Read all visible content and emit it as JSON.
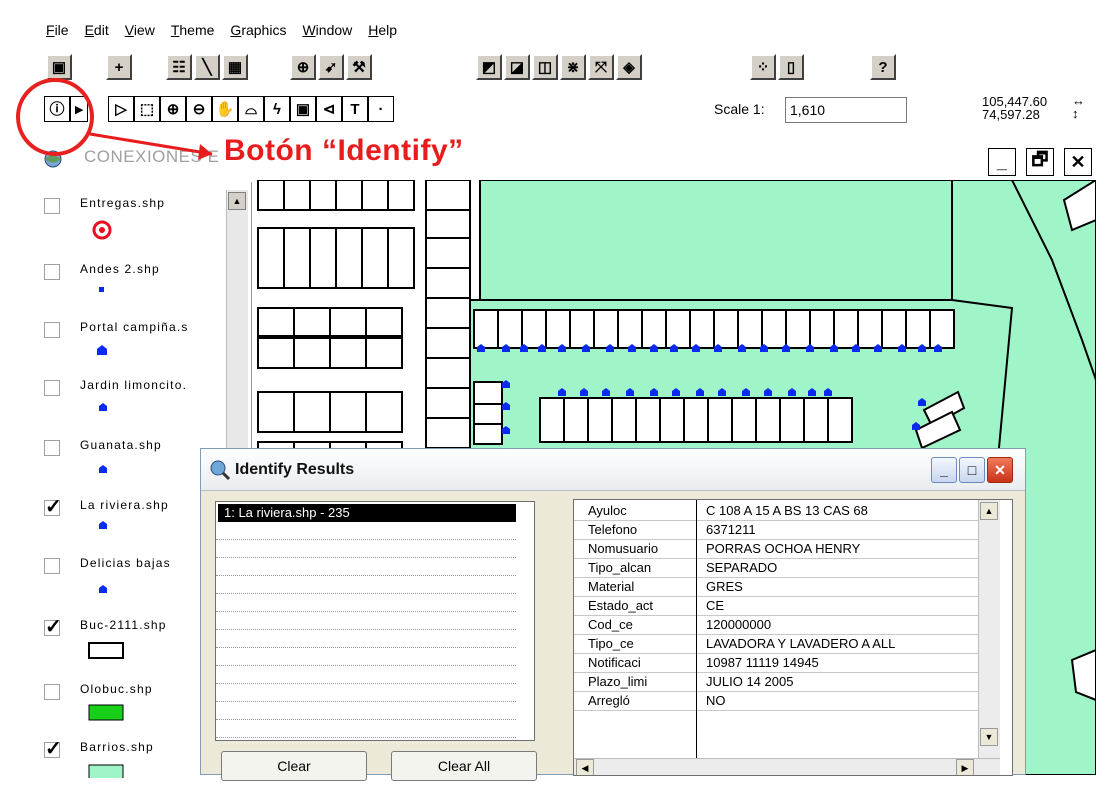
{
  "menubar": {
    "items": [
      "File",
      "Edit",
      "View",
      "Theme",
      "Graphics",
      "Window",
      "Help"
    ]
  },
  "toolbar": {
    "scale_label": "Scale 1:",
    "scale_value": "1,610",
    "coord_x": "105,447.60",
    "coord_y": "74,597.28"
  },
  "document": {
    "title": "CONEXIONES E",
    "window_controls": {
      "minimize": "_",
      "restore": "🗗",
      "close": "✕"
    }
  },
  "annotation": {
    "label": "Botón “Identify”",
    "color": "#e81c1c"
  },
  "layers": [
    {
      "name": "Entregas.shp",
      "checked": false
    },
    {
      "name": "Andes 2.shp",
      "checked": false
    },
    {
      "name": "Portal campiña.s",
      "checked": false
    },
    {
      "name": "Jardin limoncito.",
      "checked": false
    },
    {
      "name": "Guanata.shp",
      "checked": false
    },
    {
      "name": "La riviera.shp",
      "checked": true
    },
    {
      "name": "Delicias bajas",
      "checked": false
    },
    {
      "name": "Buc-2111.shp",
      "checked": true
    },
    {
      "name": "Olobuc.shp",
      "checked": false
    },
    {
      "name": "Barrios.shp",
      "checked": true
    }
  ],
  "identify_dialog": {
    "title": "Identify Results",
    "selected_feature": "1:  La riviera.shp - 235",
    "clear_button": "Clear",
    "clear_all_button": "Clear All",
    "attributes": [
      {
        "field": "Ayuloc",
        "value": "C 108 A 15 A BS 13 CAS 68"
      },
      {
        "field": "Telefono",
        "value": "6371211"
      },
      {
        "field": "Nomusuario",
        "value": "PORRAS OCHOA HENRY"
      },
      {
        "field": "Tipo_alcan",
        "value": "SEPARADO"
      },
      {
        "field": "Material",
        "value": "GRES"
      },
      {
        "field": "Estado_act",
        "value": "CE"
      },
      {
        "field": "Cod_ce",
        "value": "120000000"
      },
      {
        "field": "Tipo_ce",
        "value": "LAVADORA Y LAVADERO A ALL"
      },
      {
        "field": "Notificaci",
        "value": "10987 11119 14945"
      },
      {
        "field": "Plazo_limi",
        "value": "JULIO 14 2005"
      },
      {
        "field": "Arregló",
        "value": "NO"
      }
    ]
  },
  "colors": {
    "map_fill": "#9ff5c8",
    "point_symbol": "#0a2af0",
    "entregas_symbol": "#e81020",
    "olobuc_fill": "#18d018",
    "barrios_fill": "#9ff5c8"
  }
}
